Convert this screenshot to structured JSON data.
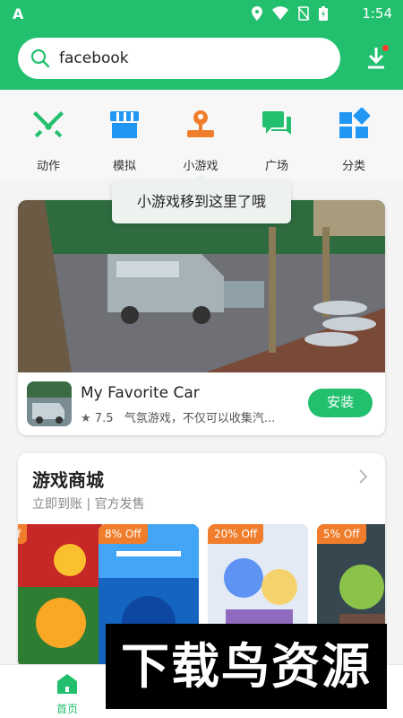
{
  "status_bar": {
    "time": "1:54",
    "app_icon": "A"
  },
  "search": {
    "value": "facebook"
  },
  "header": {
    "download_icon": "download-icon"
  },
  "categories": [
    {
      "label": "动作",
      "icon": "swords-icon",
      "color": "#22c06e"
    },
    {
      "label": "模拟",
      "icon": "storefront-icon",
      "color": "#2196f3"
    },
    {
      "label": "小游戏",
      "icon": "joystick-icon",
      "color": "#f07d2b"
    },
    {
      "label": "广场",
      "icon": "chat-icon",
      "color": "#22c06e"
    },
    {
      "label": "分类",
      "icon": "grid-icon",
      "color": "#2196f3"
    }
  ],
  "tooltip": {
    "text": "小游戏移到这里了哦"
  },
  "featured": {
    "name": "My Favorite Car",
    "rating": "7.5",
    "description": "气氛游戏，不仅可以收集汽...",
    "install_label": "安装"
  },
  "store": {
    "title": "游戏商城",
    "subtitle": "立即到账 | 官方发售",
    "games": [
      {
        "tag": "ff",
        "colors": [
          "#c62828",
          "#f9a825"
        ]
      },
      {
        "tag": "8% Off",
        "colors": [
          "#1e88e5",
          "#0d47a1"
        ]
      },
      {
        "tag": "20% Off",
        "colors": [
          "#5e92f3",
          "#f5d36c"
        ]
      },
      {
        "tag": "5% Off",
        "colors": [
          "#6d4c41",
          "#8bc34a"
        ]
      }
    ]
  },
  "bottom_nav": {
    "home_label": "首页"
  },
  "watermark": {
    "text": "下载鸟资源"
  }
}
